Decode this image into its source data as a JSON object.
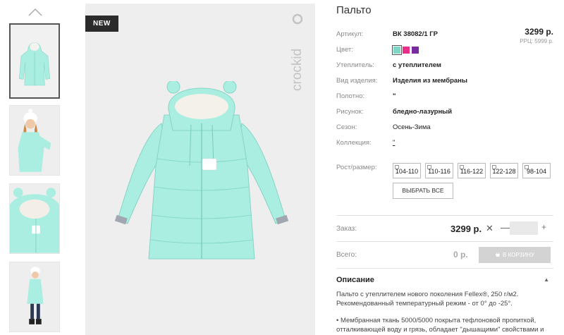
{
  "product": {
    "title": "Пальто",
    "badge": "NEW",
    "brand_logo": "crockid",
    "price": "3299 р.",
    "rrp": "РРЦ: 5999 р."
  },
  "attributes": [
    {
      "label": "Артикул:",
      "value": "ВК 38082/1 ГР",
      "bold": true
    },
    {
      "label": "Цвет:",
      "value": ""
    },
    {
      "label": "Утеплитель:",
      "value": "с утеплителем",
      "bold": true
    },
    {
      "label": "Вид изделия:",
      "value": "Изделия из мембраны",
      "bold": true
    },
    {
      "label": "Полотно:",
      "value": "\"",
      "bold": true
    },
    {
      "label": "Рисунок:",
      "value": "бледно-лазурный",
      "bold": true
    },
    {
      "label": "Сезон:",
      "value": "Осень-Зима",
      "bold": false
    },
    {
      "label": "Коллекция:",
      "value": "\"",
      "bold": false
    }
  ],
  "colors": [
    "#7fd6c7",
    "#e8308a",
    "#7a2aa0"
  ],
  "sizes": {
    "label": "Рост/размер:",
    "options": [
      "104-110",
      "110-116",
      "116-122",
      "122-128",
      "98-104"
    ],
    "select_all": "ВЫБРАТЬ ВСЕ"
  },
  "order": {
    "label": "Заказ:",
    "price": "3299 р.",
    "remove_icon": "✕",
    "minus": "—",
    "plus": "+",
    "qty": ""
  },
  "total": {
    "label": "Всего:",
    "value": "0 р.",
    "cart_button": "В КОРЗИНУ"
  },
  "description": {
    "title": "Описание",
    "toggle": "▲",
    "p1": "Пальто с утеплителем нового поколения Fellex®, 250 г/м2. Рекомендованный температурный режим - от 0° до -25°.",
    "p2": "• Мембранная ткань 5000/5000 покрыта тефлоновой пропиткой, отталкивающей воду и грязь, обладает \"дышащими\" свойствами и"
  }
}
